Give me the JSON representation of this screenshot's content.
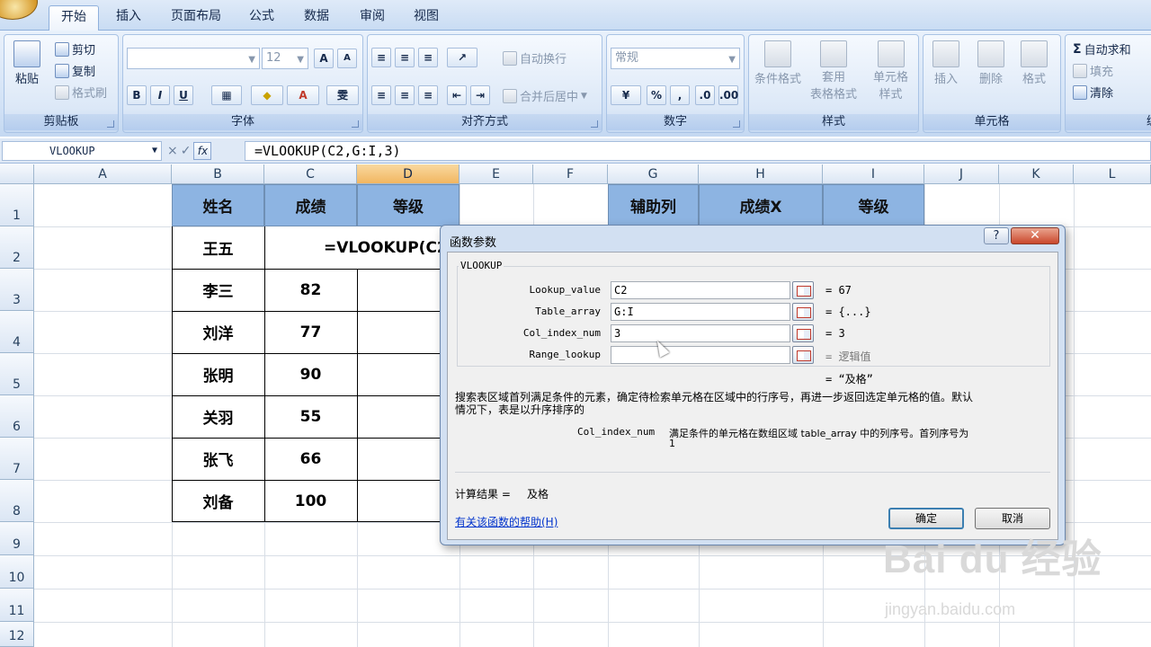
{
  "tabs": [
    "开始",
    "插入",
    "页面布局",
    "公式",
    "数据",
    "审阅",
    "视图"
  ],
  "active_tab": "开始",
  "clipboard": {
    "paste": "粘贴",
    "cut": "剪切",
    "copy": "复制",
    "format_painter": "格式刷",
    "title": "剪贴板"
  },
  "font": {
    "size": "12",
    "bold": "B",
    "italic": "I",
    "underline": "U",
    "grow": "A",
    "shrink": "A",
    "title": "字体"
  },
  "alignment": {
    "wrap": "自动换行",
    "merge": "合并后居中",
    "title": "对齐方式"
  },
  "number": {
    "format": "常规",
    "percent": "%",
    "comma": ",",
    "title": "数字"
  },
  "styles": {
    "conditional": "条件格式",
    "table_line1": "套用",
    "table_line2": "表格格式",
    "cell_line1": "单元格",
    "cell_line2": "样式",
    "title": "样式"
  },
  "cells": {
    "insert": "插入",
    "delete": "删除",
    "format": "格式",
    "title": "单元格"
  },
  "editing": {
    "autosum": "自动求和",
    "fill": "填充",
    "clear": "清除",
    "title": "编"
  },
  "formula_bar": {
    "name_box": "VLOOKUP",
    "cancel": "×",
    "enter": "✓",
    "fx": "fx",
    "formula": "=VLOOKUP(C2,G:I,3)"
  },
  "columns": [
    "A",
    "B",
    "C",
    "D",
    "E",
    "F",
    "G",
    "H",
    "I",
    "J",
    "K",
    "L"
  ],
  "rows": [
    "1",
    "2",
    "3",
    "4",
    "5",
    "6",
    "7",
    "8",
    "9",
    "10",
    "11",
    "12"
  ],
  "table": {
    "headers": [
      "姓名",
      "成绩",
      "等级"
    ],
    "edit_formula": "=VLOOKUP(C2,G",
    "rows": [
      {
        "name": "王五",
        "score": ""
      },
      {
        "name": "李三",
        "score": "82"
      },
      {
        "name": "刘洋",
        "score": "77"
      },
      {
        "name": "张明",
        "score": "90"
      },
      {
        "name": "关羽",
        "score": "55"
      },
      {
        "name": "张飞",
        "score": "66"
      },
      {
        "name": "刘备",
        "score": "100"
      }
    ]
  },
  "helper_table": {
    "headers": [
      "辅助列",
      "成绩X",
      "等级"
    ]
  },
  "dialog": {
    "title": "函数参数",
    "help_btn": "?",
    "close_btn": "✕",
    "function_name": "VLOOKUP",
    "args": [
      {
        "label": "Lookup_value",
        "value": "C2",
        "result": "= 67"
      },
      {
        "label": "Table_array",
        "value": "G:I",
        "result": "= {...}"
      },
      {
        "label": "Col_index_num",
        "value": "3",
        "result": "= 3"
      },
      {
        "label": "Range_lookup",
        "value": "",
        "result": "= 逻辑值"
      }
    ],
    "overall_result": "= “及格”",
    "description_line1": "搜索表区域首列满足条件的元素，确定待检索单元格在区域中的行序号，再进一步返回选定单元格的值。默认",
    "description_line2": "情况下，表是以升序排序的",
    "param_name": "Col_index_num",
    "param_desc_line1": "满足条件的单元格在数组区域 table_array 中的列序号。首列序号为",
    "param_desc_line2": "1",
    "calc_result_label": "计算结果 =",
    "calc_result_value": "及格",
    "help_link": "有关该函数的帮助(H)",
    "ok": "确定",
    "cancel": "取消"
  },
  "watermark": {
    "brand": "Bai du 经验",
    "url": "jingyan.baidu.com"
  }
}
